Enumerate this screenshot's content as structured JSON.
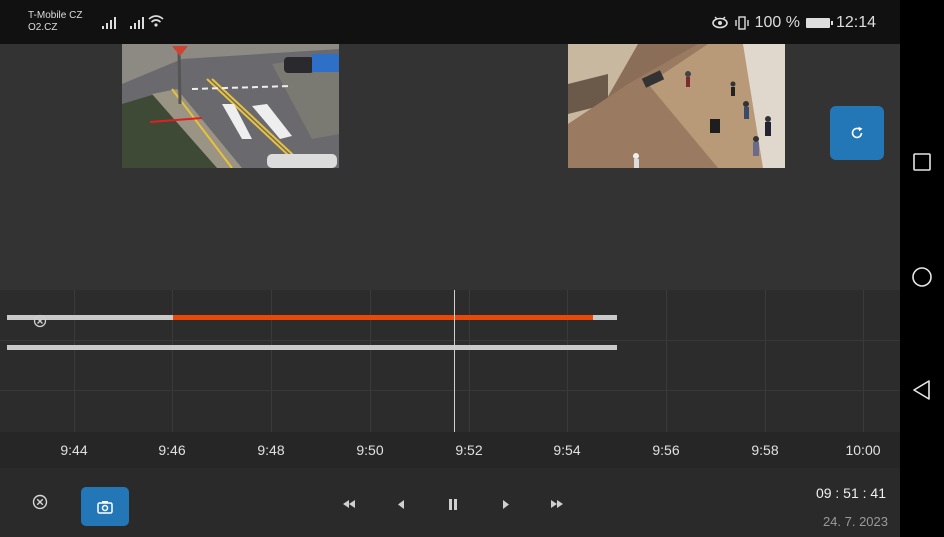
{
  "status_bar": {
    "carrier_1": "T-Mobile CZ",
    "carrier_2": "O2.CZ",
    "battery_text": "100 %",
    "clock": "12:14",
    "icons": [
      "signal-icon",
      "signal-icon",
      "wifi-icon",
      "eye-icon",
      "vibrate-icon",
      "battery-icon"
    ]
  },
  "nav_bar": {
    "icons": [
      "square-recents-icon",
      "circle-home-icon",
      "triangle-back-icon"
    ]
  },
  "player": {
    "refresh_icon": "refresh-icon",
    "timeline": {
      "tracks": [
        {
          "name": "camera-1",
          "recorded_segment": [
            "9:46",
            "9:54"
          ],
          "has_data_until": "9:55"
        },
        {
          "name": "camera-2",
          "has_data_until": "9:55"
        }
      ],
      "current_time_position": "9:52",
      "ticks": [
        "9:44",
        "9:46",
        "9:48",
        "9:50",
        "9:52",
        "9:54",
        "9:56",
        "9:58",
        "10:00"
      ]
    },
    "controls": {
      "close_icon": "close-circle-icon",
      "snapshot_icon": "camera-icon",
      "fast_rewind_icon": "fast-rewind-icon",
      "step_back_icon": "step-back-icon",
      "pause_icon": "pause-icon",
      "step_forward_icon": "step-forward-icon",
      "fast_forward_icon": "fast-forward-icon",
      "time": "09 : 51 : 41",
      "date": "24. 7. 2023"
    },
    "colors": {
      "accent_blue": "#2377b7",
      "recording_orange": "#e8480a"
    }
  }
}
